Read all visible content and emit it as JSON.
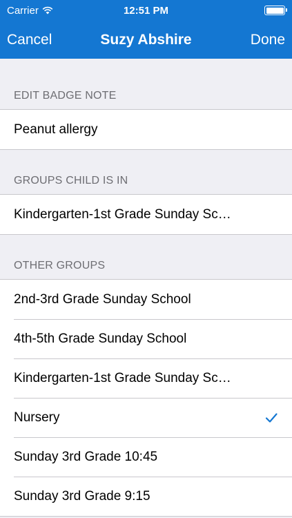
{
  "status": {
    "carrier": "Carrier",
    "time": "12:51 PM"
  },
  "nav": {
    "cancel": "Cancel",
    "title": "Suzy Abshire",
    "done": "Done"
  },
  "badge_note": {
    "header": "EDIT BADGE NOTE",
    "value": "Peanut allergy"
  },
  "groups_in": {
    "header": "GROUPS CHILD IS IN",
    "items": [
      "Kindergarten-1st Grade Sunday Sc…"
    ]
  },
  "other_groups": {
    "header": "OTHER GROUPS",
    "items": [
      "2nd-3rd Grade Sunday School",
      "4th-5th Grade Sunday School",
      "Kindergarten-1st Grade Sunday Sc…",
      "Nursery",
      "Sunday 3rd Grade 10:45",
      "Sunday 3rd Grade 9:15"
    ],
    "checked_index": 3
  },
  "colors": {
    "accent": "#1477d2",
    "background": "#efeff4"
  }
}
